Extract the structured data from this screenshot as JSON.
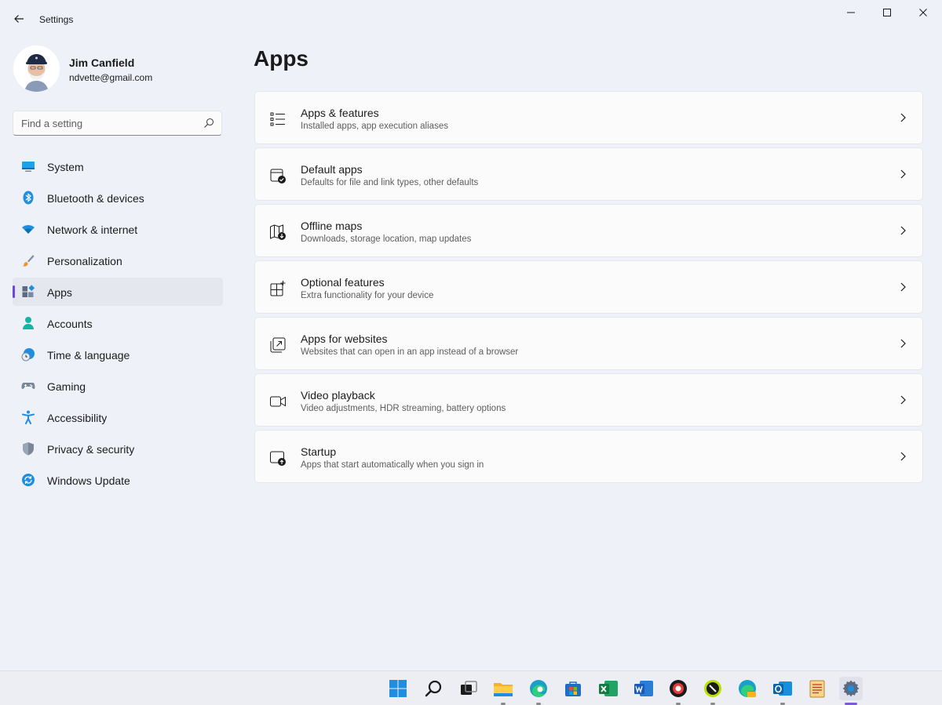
{
  "window": {
    "title": "Settings"
  },
  "profile": {
    "name": "Jim Canfield",
    "email": "ndvette@gmail.com"
  },
  "search": {
    "placeholder": "Find a setting",
    "value": ""
  },
  "nav": {
    "selected": "Apps",
    "items": [
      {
        "label": "System",
        "icon": "system-icon"
      },
      {
        "label": "Bluetooth & devices",
        "icon": "bluetooth-icon"
      },
      {
        "label": "Network & internet",
        "icon": "wifi-icon"
      },
      {
        "label": "Personalization",
        "icon": "brush-icon"
      },
      {
        "label": "Apps",
        "icon": "apps-icon"
      },
      {
        "label": "Accounts",
        "icon": "person-icon"
      },
      {
        "label": "Time & language",
        "icon": "clock-globe-icon"
      },
      {
        "label": "Gaming",
        "icon": "gamepad-icon"
      },
      {
        "label": "Accessibility",
        "icon": "accessibility-icon"
      },
      {
        "label": "Privacy & security",
        "icon": "shield-icon"
      },
      {
        "label": "Windows Update",
        "icon": "update-icon"
      }
    ]
  },
  "main": {
    "title": "Apps",
    "cards": [
      {
        "title": "Apps & features",
        "subtitle": "Installed apps, app execution aliases",
        "icon": "list-icon"
      },
      {
        "title": "Default apps",
        "subtitle": "Defaults for file and link types, other defaults",
        "icon": "default-apps-icon"
      },
      {
        "title": "Offline maps",
        "subtitle": "Downloads, storage location, map updates",
        "icon": "map-download-icon"
      },
      {
        "title": "Optional features",
        "subtitle": "Extra functionality for your device",
        "icon": "grid-add-icon"
      },
      {
        "title": "Apps for websites",
        "subtitle": "Websites that can open in an app instead of a browser",
        "icon": "open-external-icon"
      },
      {
        "title": "Video playback",
        "subtitle": "Video adjustments, HDR streaming, battery options",
        "icon": "video-camera-icon"
      },
      {
        "title": "Startup",
        "subtitle": "Apps that start automatically when you sign in",
        "icon": "startup-icon"
      }
    ]
  },
  "taskbar": {
    "items": [
      {
        "icon": "windows-start-icon"
      },
      {
        "icon": "search-icon"
      },
      {
        "icon": "task-view-icon"
      },
      {
        "icon": "file-explorer-icon"
      },
      {
        "icon": "edge-icon"
      },
      {
        "icon": "store-icon"
      },
      {
        "icon": "excel-icon"
      },
      {
        "icon": "word-icon"
      },
      {
        "icon": "app-red-icon"
      },
      {
        "icon": "app-green-icon"
      },
      {
        "icon": "edge-canary-icon"
      },
      {
        "icon": "outlook-icon"
      },
      {
        "icon": "notepad-icon"
      },
      {
        "icon": "settings-gear-icon"
      }
    ]
  },
  "colors": {
    "accent": "#6c47d9",
    "background": "#eef1f7",
    "card": "#fbfbfc"
  }
}
